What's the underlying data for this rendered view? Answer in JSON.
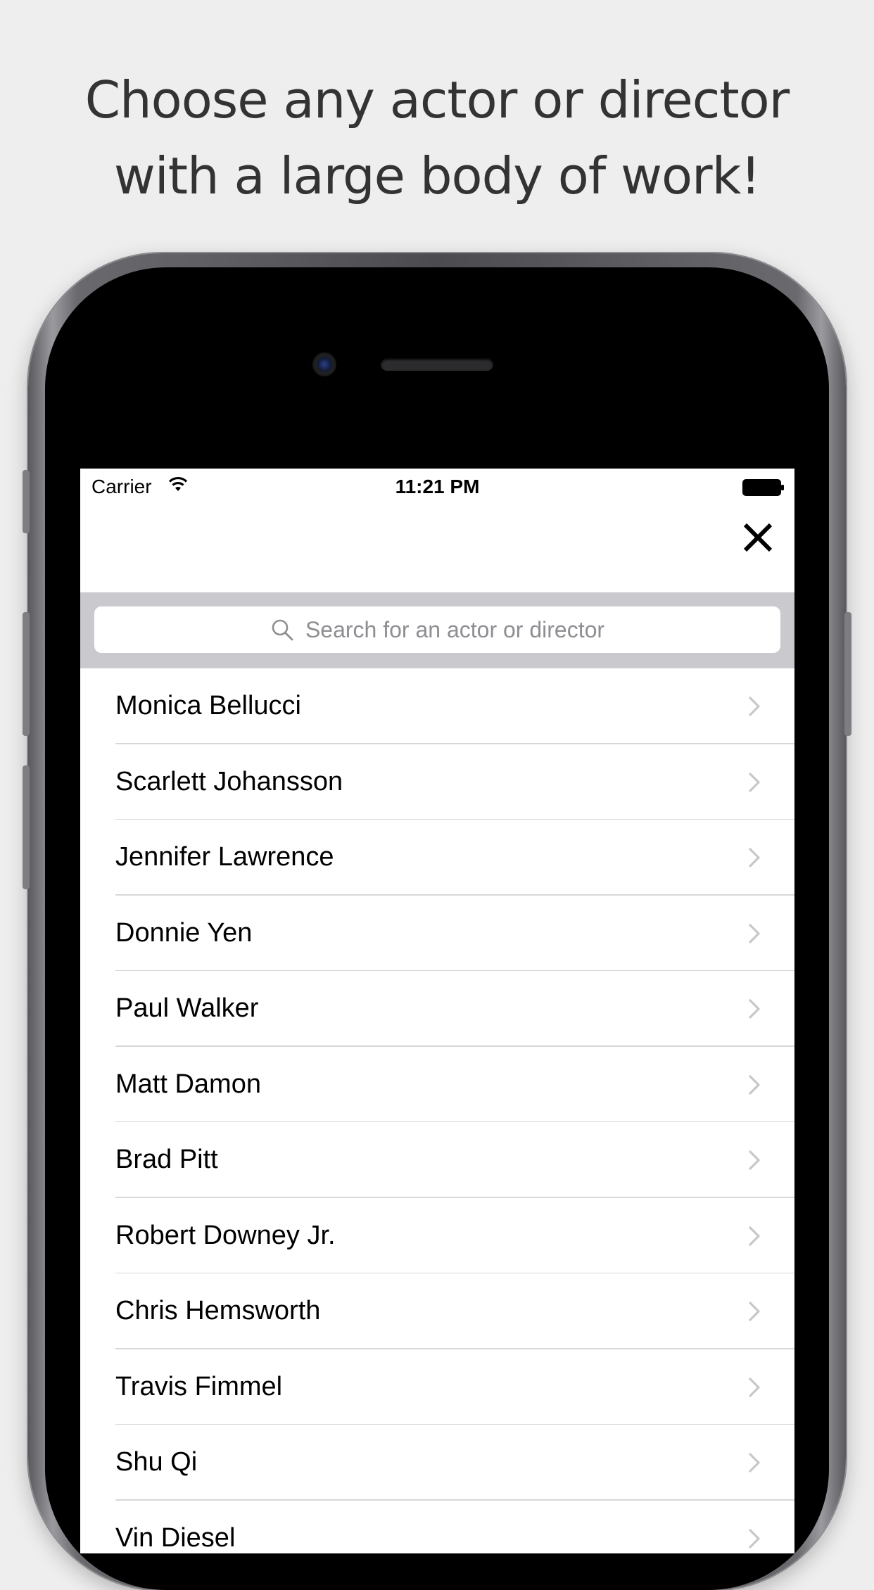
{
  "headline": {
    "line1": "Choose any actor or director",
    "line2": "with a large body of work!"
  },
  "status_bar": {
    "carrier": "Carrier",
    "time": "11:21 PM"
  },
  "nav": {
    "close_icon": "close-x-icon"
  },
  "search": {
    "placeholder": "Search for an actor or director",
    "icon": "search-icon"
  },
  "people": [
    {
      "name": "Monica Bellucci"
    },
    {
      "name": "Scarlett Johansson"
    },
    {
      "name": "Jennifer Lawrence"
    },
    {
      "name": "Donnie Yen"
    },
    {
      "name": "Paul Walker"
    },
    {
      "name": "Matt Damon"
    },
    {
      "name": "Brad Pitt"
    },
    {
      "name": "Robert Downey Jr."
    },
    {
      "name": "Chris Hemsworth"
    },
    {
      "name": "Travis Fimmel"
    },
    {
      "name": "Shu Qi"
    },
    {
      "name": "Vin Diesel"
    }
  ],
  "colors": {
    "page_background": "#eeeeee",
    "search_bar_background": "#c9c9ce",
    "chevron": "#c7c7cc",
    "placeholder": "#8e8e93"
  }
}
